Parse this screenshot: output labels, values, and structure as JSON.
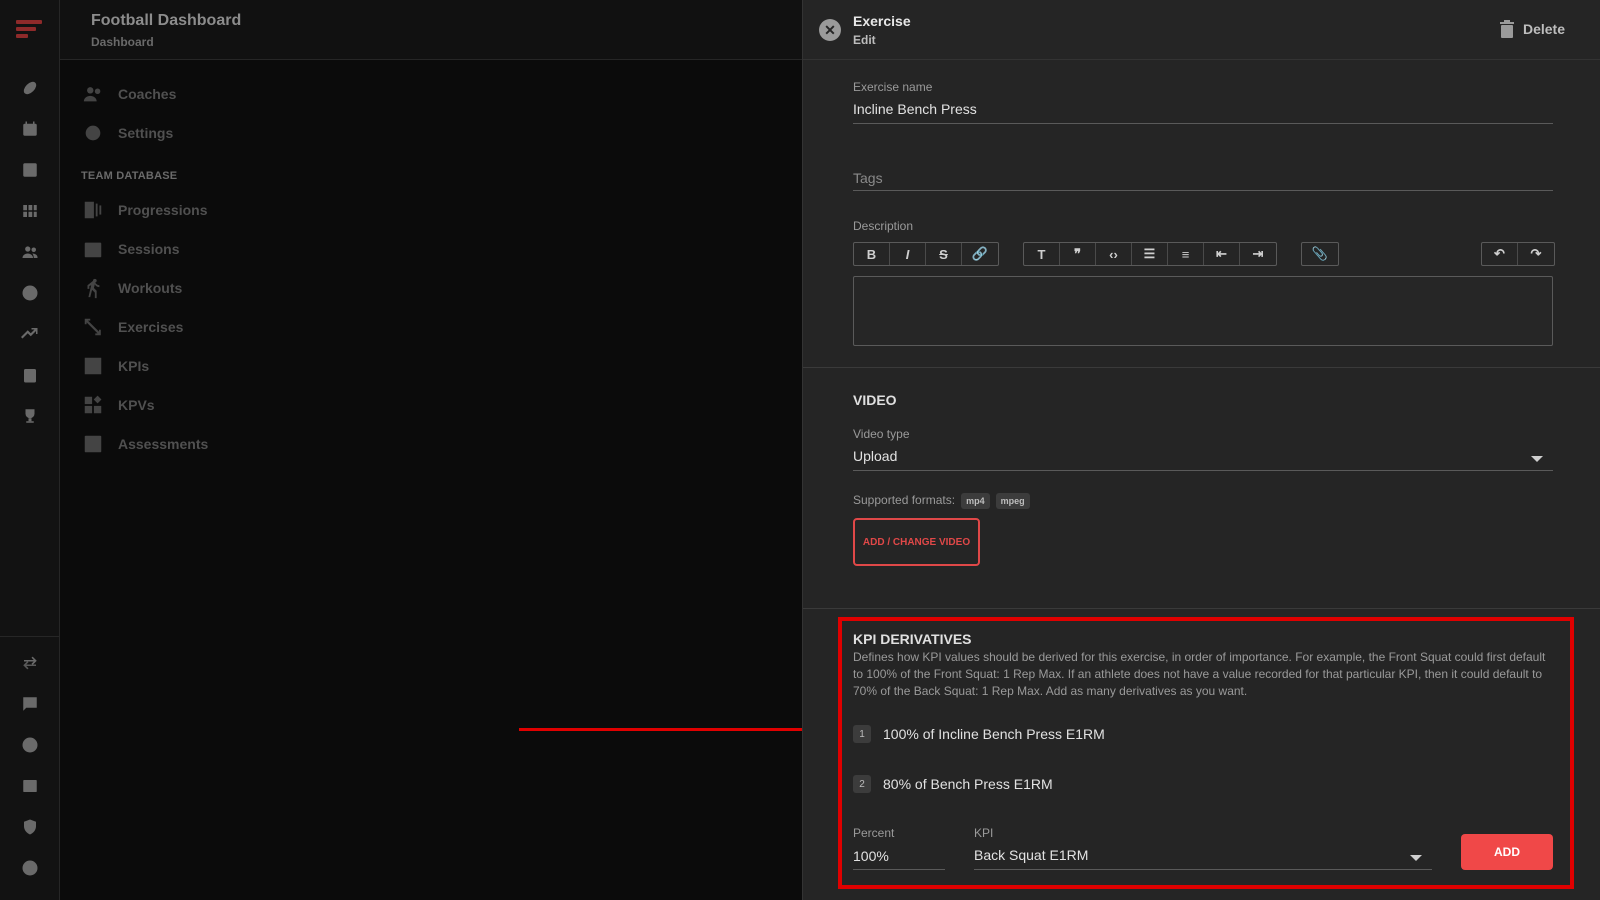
{
  "app": {
    "title": "Football Dashboard",
    "breadcrumb": "Dashboard"
  },
  "rail": {
    "icons": [
      "football-icon",
      "calendar-icon",
      "notes-icon",
      "grid-icon",
      "people-icon",
      "soccer-ball-icon",
      "trending-icon",
      "clipboard-icon",
      "trophy-icon",
      "swap-icon",
      "chat-icon",
      "help-icon",
      "table-icon",
      "shield-icon",
      "account-icon"
    ]
  },
  "nav": {
    "items_top": [
      {
        "label": "Coaches",
        "icon": "people-icon"
      },
      {
        "label": "Settings",
        "icon": "gear-icon"
      }
    ],
    "section_label": "TEAM DATABASE",
    "items_db": [
      {
        "label": "Progressions",
        "icon": "progression-icon"
      },
      {
        "label": "Sessions",
        "icon": "calendar-icon"
      },
      {
        "label": "Workouts",
        "icon": "running-icon"
      },
      {
        "label": "Exercises",
        "icon": "exercise-icon"
      },
      {
        "label": "KPIs",
        "icon": "bar-chart-icon"
      },
      {
        "label": "KPVs",
        "icon": "widgets-icon"
      },
      {
        "label": "Assessments",
        "icon": "checklist-icon"
      }
    ]
  },
  "drawer": {
    "title": "Exercise",
    "subtitle": "Edit",
    "delete_label": "Delete",
    "exercise_name_label": "Exercise name",
    "exercise_name_value": "Incline Bench Press",
    "tags_placeholder": "Tags",
    "description_label": "Description",
    "toolbar": {
      "group1": [
        "B",
        "I",
        "S",
        "link"
      ],
      "group2": [
        "heading",
        "quote",
        "code",
        "bullet-list",
        "numbered-list",
        "outdent",
        "indent"
      ],
      "group3": [
        "attach"
      ],
      "group4": [
        "undo",
        "redo"
      ]
    },
    "video": {
      "section_title": "VIDEO",
      "type_label": "Video type",
      "type_value": "Upload",
      "formats_label": "Supported formats:",
      "formats": [
        "mp4",
        "mpeg"
      ],
      "button_label": "ADD / CHANGE VIDEO"
    },
    "kpi": {
      "section_title": "KPI DERIVATIVES",
      "description": "Defines how KPI values should be derived for this exercise, in order of importance. For example, the Front Squat could first default to 100% of the Front Squat: 1 Rep Max. If an athlete does not have a value recorded for that particular KPI, then it could default to 70% of the Back Squat: 1 Rep Max. Add as many derivatives as you want.",
      "derivatives": [
        {
          "num": "1",
          "text": "100% of Incline Bench Press E1RM"
        },
        {
          "num": "2",
          "text": "80% of Bench Press E1RM"
        }
      ],
      "percent_label": "Percent",
      "percent_value": "100%",
      "kpi_label": "KPI",
      "kpi_value": "Back Squat E1RM",
      "add_label": "ADD"
    }
  },
  "colors": {
    "accent": "#f04848",
    "annotation": "#e00000"
  }
}
